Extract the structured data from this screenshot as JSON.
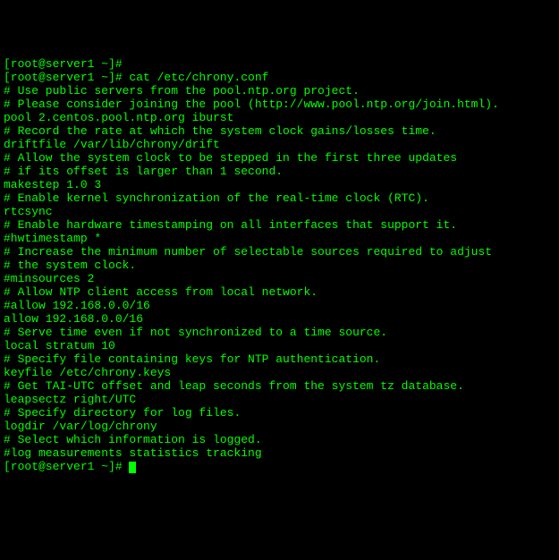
{
  "terminal": {
    "lines": [
      "[root@server1 ~]#",
      "[root@server1 ~]# cat /etc/chrony.conf",
      "# Use public servers from the pool.ntp.org project.",
      "# Please consider joining the pool (http://www.pool.ntp.org/join.html).",
      "pool 2.centos.pool.ntp.org iburst",
      "",
      "# Record the rate at which the system clock gains/losses time.",
      "driftfile /var/lib/chrony/drift",
      "",
      "# Allow the system clock to be stepped in the first three updates",
      "# if its offset is larger than 1 second.",
      "makestep 1.0 3",
      "",
      "# Enable kernel synchronization of the real-time clock (RTC).",
      "rtcsync",
      "",
      "# Enable hardware timestamping on all interfaces that support it.",
      "#hwtimestamp *",
      "",
      "# Increase the minimum number of selectable sources required to adjust",
      "# the system clock.",
      "#minsources 2",
      "",
      "# Allow NTP client access from local network.",
      "#allow 192.168.0.0/16",
      "allow 192.168.0.0/16",
      "",
      "# Serve time even if not synchronized to a time source.",
      "local stratum 10",
      "",
      "# Specify file containing keys for NTP authentication.",
      "keyfile /etc/chrony.keys",
      "",
      "# Get TAI-UTC offset and leap seconds from the system tz database.",
      "leapsectz right/UTC",
      "",
      "# Specify directory for log files.",
      "logdir /var/log/chrony",
      "",
      "# Select which information is logged.",
      "#log measurements statistics tracking"
    ],
    "final_prompt": "[root@server1 ~]# "
  }
}
